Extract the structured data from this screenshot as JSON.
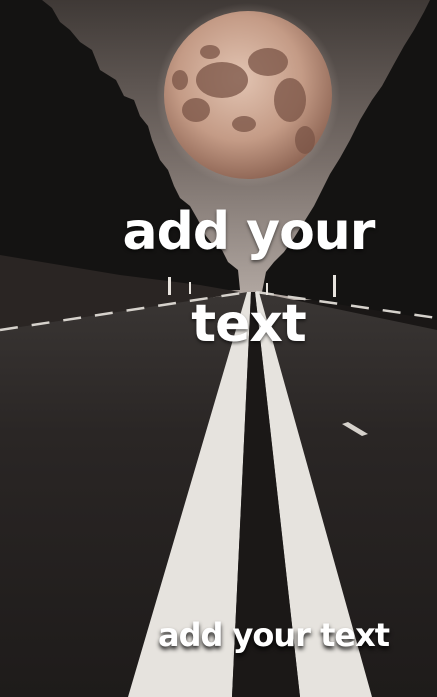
{
  "headline": {
    "line1": "add your",
    "line2": "text"
  },
  "subline": "add your text",
  "colors": {
    "sky_top": "#4e4642",
    "sky_horizon": "#a69c96",
    "forest": "#141413",
    "asphalt": "#262322",
    "lane_paint": "#e8e6e2",
    "moon": "#c9a18e",
    "text": "#ffffff"
  }
}
